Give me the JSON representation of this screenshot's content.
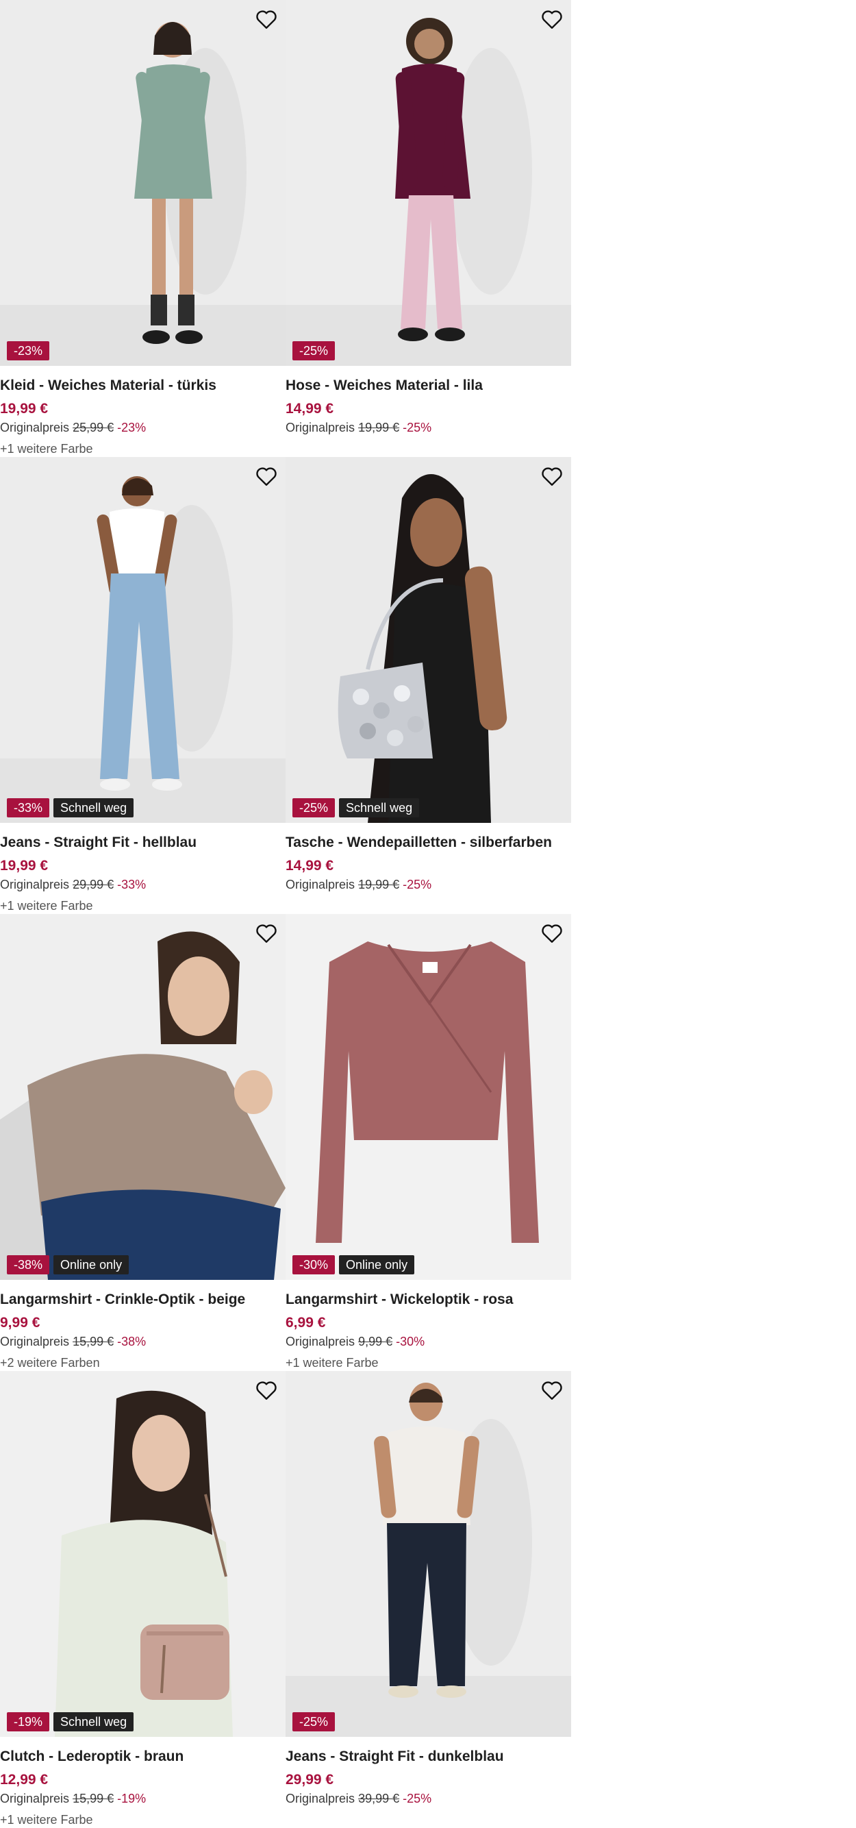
{
  "colors": {
    "accent": "#a8123e",
    "tag_bg": "#222222"
  },
  "products": [
    {
      "title": "Kleid - Weiches Material - türkis",
      "price": "19,99 €",
      "original_label": "Originalpreis",
      "original_price": "25,99 €",
      "discount": "-23%",
      "badge_discount": "-23%",
      "badge_tag": "",
      "more_colors": "+1 weitere Farbe",
      "image": "model-teal-dress"
    },
    {
      "title": "Hose - Weiches Material - lila",
      "price": "14,99 €",
      "original_label": "Originalpreis",
      "original_price": "19,99 €",
      "discount": "-25%",
      "badge_discount": "-25%",
      "badge_tag": "",
      "more_colors": "",
      "image": "model-burgundy-blouse-pink-pants"
    },
    {
      "title": "Jeans - Straight Fit - hellblau",
      "price": "19,99 €",
      "original_label": "Originalpreis",
      "original_price": "29,99 €",
      "discount": "-33%",
      "badge_discount": "-33%",
      "badge_tag": "Schnell weg",
      "more_colors": "+1 weitere Farbe",
      "image": "model-light-blue-jeans"
    },
    {
      "title": "Tasche - Wendepailletten - silberfarben",
      "price": "14,99 €",
      "original_label": "Originalpreis",
      "original_price": "19,99 €",
      "discount": "-25%",
      "badge_discount": "-25%",
      "badge_tag": "Schnell weg",
      "more_colors": "",
      "image": "model-silver-sequin-bag"
    },
    {
      "title": "Langarmshirt - Crinkle-Optik - beige",
      "price": "9,99 €",
      "original_label": "Originalpreis",
      "original_price": "15,99 €",
      "discount": "-38%",
      "badge_discount": "-38%",
      "badge_tag": "Online only",
      "more_colors": "+2 weitere Farben",
      "image": "model-beige-crinkle-top"
    },
    {
      "title": "Langarmshirt - Wickeloptik - rosa",
      "price": "6,99 €",
      "original_label": "Originalpreis",
      "original_price": "9,99 €",
      "discount": "-30%",
      "badge_discount": "-30%",
      "badge_tag": "Online only",
      "more_colors": "+1 weitere Farbe",
      "image": "product-rose-wrap-shirt"
    },
    {
      "title": "Clutch - Lederoptik - braun",
      "price": "12,99 €",
      "original_label": "Originalpreis",
      "original_price": "15,99 €",
      "discount": "-19%",
      "badge_discount": "-19%",
      "badge_tag": "Schnell weg",
      "more_colors": "+1 weitere Farbe",
      "image": "model-taupe-clutch"
    },
    {
      "title": "Jeans - Straight Fit - dunkelblau",
      "price": "29,99 €",
      "original_label": "Originalpreis",
      "original_price": "39,99 €",
      "discount": "-25%",
      "badge_discount": "-25%",
      "badge_tag": "",
      "more_colors": "",
      "image": "model-dark-blue-jeans"
    }
  ],
  "icons": {
    "wishlist": "heart-outline-icon"
  }
}
